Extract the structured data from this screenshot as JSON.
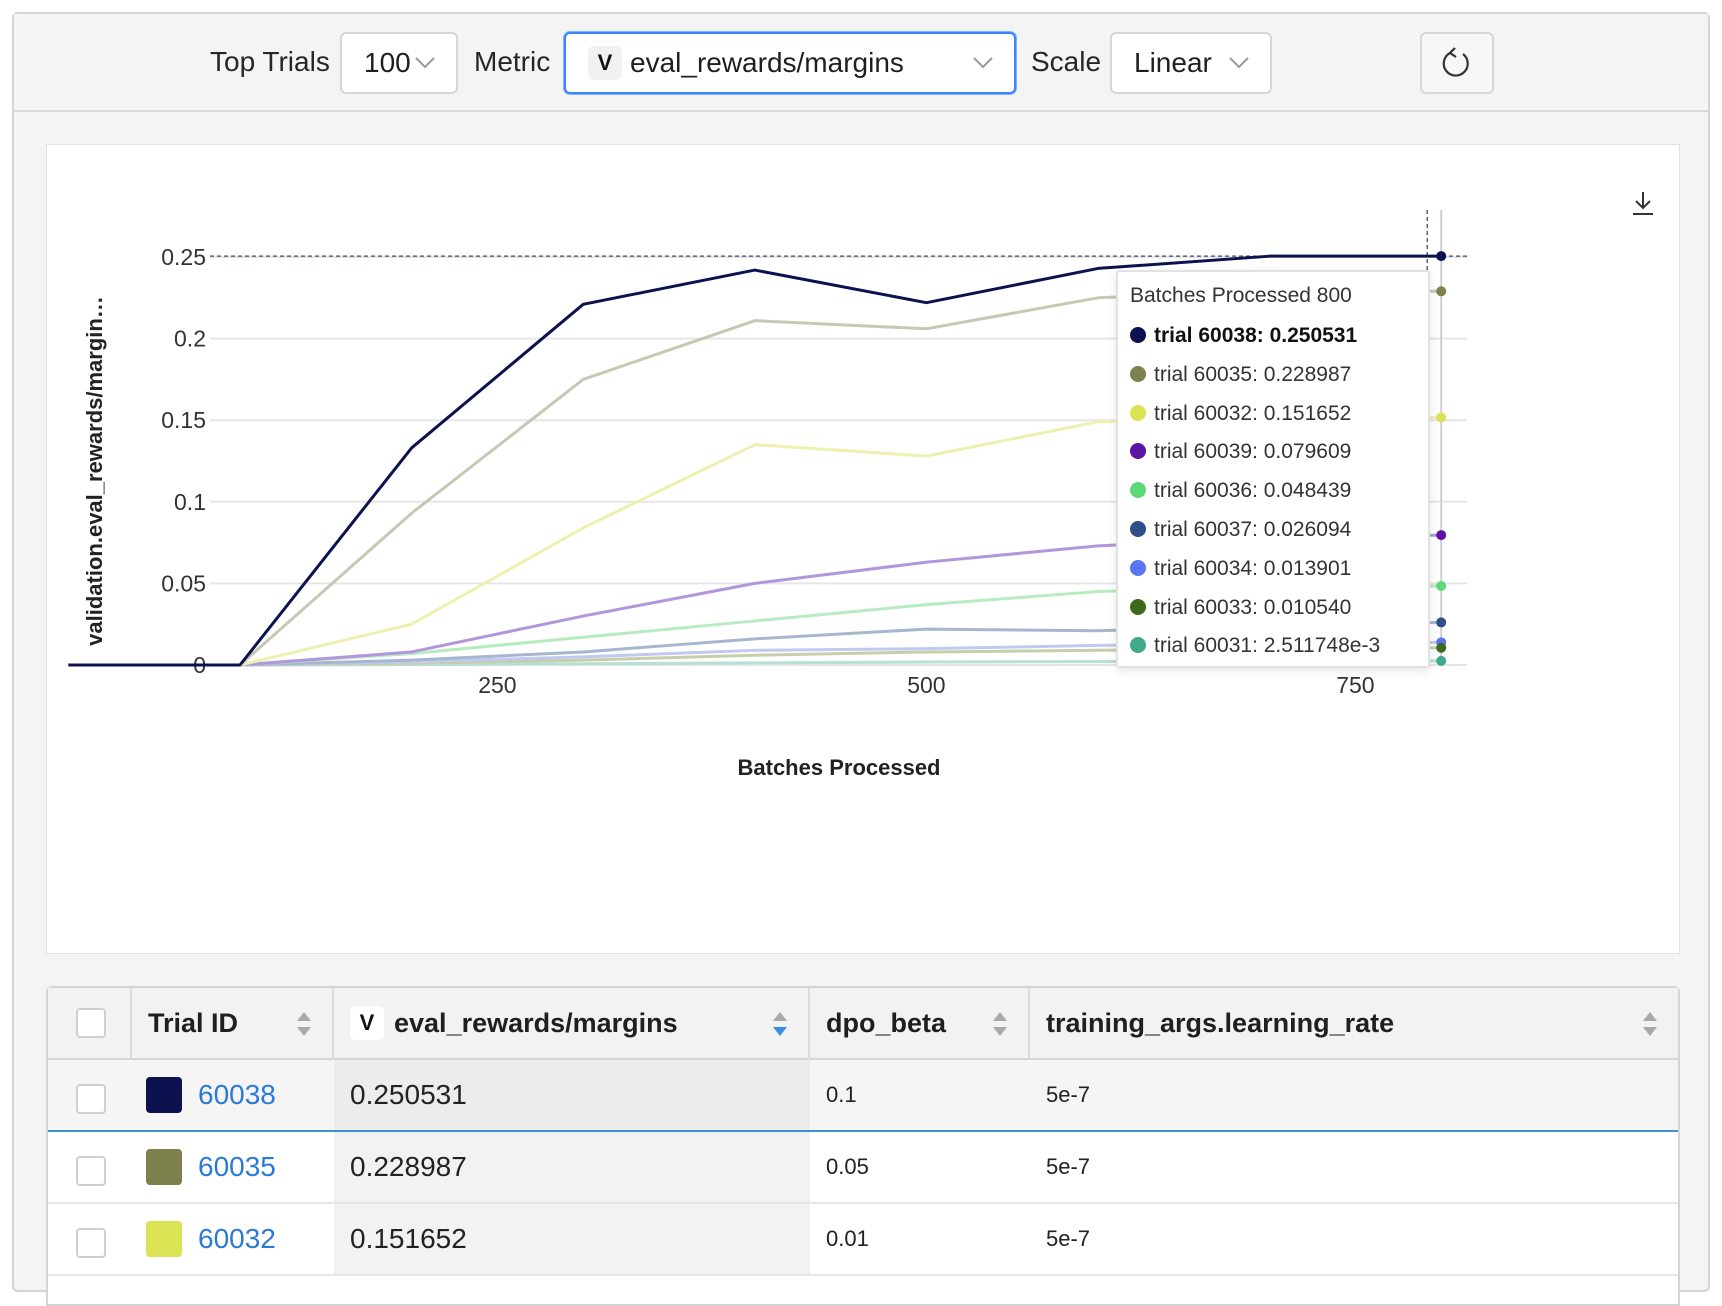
{
  "toolbar": {
    "top_trials_label": "Top Trials",
    "top_trials_value": "100",
    "metric_label": "Metric",
    "metric_badge": "V",
    "metric_value": "eval_rewards/margins",
    "scale_label": "Scale",
    "scale_value": "Linear",
    "refresh_icon": "refresh-icon"
  },
  "chart_data": {
    "type": "line",
    "xlabel": "Batches Processed",
    "ylabel": "validation.eval_rewards/margin…",
    "xticks": [
      250,
      500,
      750
    ],
    "yticks": [
      0,
      0.05,
      0.1,
      0.15,
      0.2,
      0.25
    ],
    "ytick_labels": [
      "0",
      "0.05",
      "0.1",
      "0.15",
      "0.2",
      "0.25"
    ],
    "xlim": [
      100,
      820
    ],
    "ylim": [
      0,
      0.25
    ],
    "hover_x": 800,
    "x": [
      0,
      100,
      200,
      300,
      400,
      500,
      600,
      700,
      800
    ],
    "series": [
      {
        "name": "trial 60038",
        "color": "#0b124f",
        "width": 3,
        "opacity": 1.0,
        "values": [
          0,
          0,
          0.133,
          0.221,
          0.242,
          0.222,
          0.243,
          0.2505,
          0.250531
        ]
      },
      {
        "name": "trial 60035",
        "color": "#c7c8b3",
        "end_color": "#7e814e",
        "width": 3,
        "opacity": 1.0,
        "values": [
          0,
          0,
          0.093,
          0.175,
          0.211,
          0.206,
          0.225,
          0.229,
          0.228987
        ]
      },
      {
        "name": "trial 60032",
        "color": "#eff0b0",
        "end_color": "#dbe253",
        "width": 3,
        "opacity": 1.0,
        "values": [
          0,
          0,
          0.025,
          0.084,
          0.135,
          0.128,
          0.149,
          0.152,
          0.151652
        ]
      },
      {
        "name": "trial 60039",
        "color": "#b296dc",
        "end_color": "#5c14a6",
        "width": 3,
        "opacity": 1.0,
        "values": [
          0,
          0,
          0.008,
          0.03,
          0.05,
          0.063,
          0.073,
          0.078,
          0.079609
        ]
      },
      {
        "name": "trial 60036",
        "color": "#b7ecc1",
        "end_color": "#5ed977",
        "width": 3,
        "opacity": 1.0,
        "values": [
          0,
          0,
          0.007,
          0.017,
          0.027,
          0.037,
          0.045,
          0.048,
          0.048439
        ]
      },
      {
        "name": "trial 60037",
        "color": "#a7b6cf",
        "end_color": "#2e4f8a",
        "width": 3,
        "opacity": 1.0,
        "values": [
          0,
          0,
          0.003,
          0.008,
          0.016,
          0.022,
          0.021,
          0.024,
          0.026094
        ]
      },
      {
        "name": "trial 60034",
        "color": "#c1c9f2",
        "end_color": "#5b74f1",
        "width": 3,
        "opacity": 1.0,
        "values": [
          0,
          0,
          0.002,
          0.005,
          0.009,
          0.01,
          0.012,
          0.013,
          0.013901
        ]
      },
      {
        "name": "trial 60033",
        "color": "#c6cfa9",
        "end_color": "#3e6a1c",
        "width": 3,
        "opacity": 1.0,
        "values": [
          0,
          0,
          0.001,
          0.003,
          0.006,
          0.008,
          0.009,
          0.01,
          0.01054
        ]
      },
      {
        "name": "trial 60031",
        "color": "#b6e0d4",
        "end_color": "#41a88c",
        "width": 3,
        "opacity": 1.0,
        "values": [
          0,
          0,
          0.0003,
          0.0008,
          0.0013,
          0.0018,
          0.0021,
          0.0024,
          0.002512
        ]
      }
    ]
  },
  "tooltip": {
    "title": "Batches Processed 800",
    "rows": [
      {
        "label": "trial 60038: 0.250531",
        "color": "#0b124f",
        "bold": true
      },
      {
        "label": "trial 60035: 0.228987",
        "color": "#7e814e",
        "bold": false
      },
      {
        "label": "trial 60032: 0.151652",
        "color": "#dbe253",
        "bold": false
      },
      {
        "label": "trial 60039: 0.079609",
        "color": "#5c14a6",
        "bold": false
      },
      {
        "label": "trial 60036: 0.048439",
        "color": "#5ed977",
        "bold": false
      },
      {
        "label": "trial 60037: 0.026094",
        "color": "#2e4f8a",
        "bold": false
      },
      {
        "label": "trial 60034: 0.013901",
        "color": "#5b74f1",
        "bold": false
      },
      {
        "label": "trial 60033: 0.010540",
        "color": "#3e6a1c",
        "bold": false
      },
      {
        "label": "trial 60031: 2.511748e-3",
        "color": "#41a88c",
        "bold": false
      }
    ]
  },
  "table": {
    "headers": {
      "trial_id": "Trial ID",
      "metric_badge": "V",
      "metric": "eval_rewards/margins",
      "dpo_beta": "dpo_beta",
      "learning_rate": "training_args.learning_rate"
    },
    "rows": [
      {
        "trial_id": "60038",
        "color": "#0b124f",
        "metric": "0.250531",
        "dpo_beta": "0.1",
        "learning_rate": "5e-7"
      },
      {
        "trial_id": "60035",
        "color": "#7e814e",
        "metric": "0.228987",
        "dpo_beta": "0.05",
        "learning_rate": "5e-7"
      },
      {
        "trial_id": "60032",
        "color": "#dbe253",
        "metric": "0.151652",
        "dpo_beta": "0.01",
        "learning_rate": "5e-7"
      }
    ]
  }
}
